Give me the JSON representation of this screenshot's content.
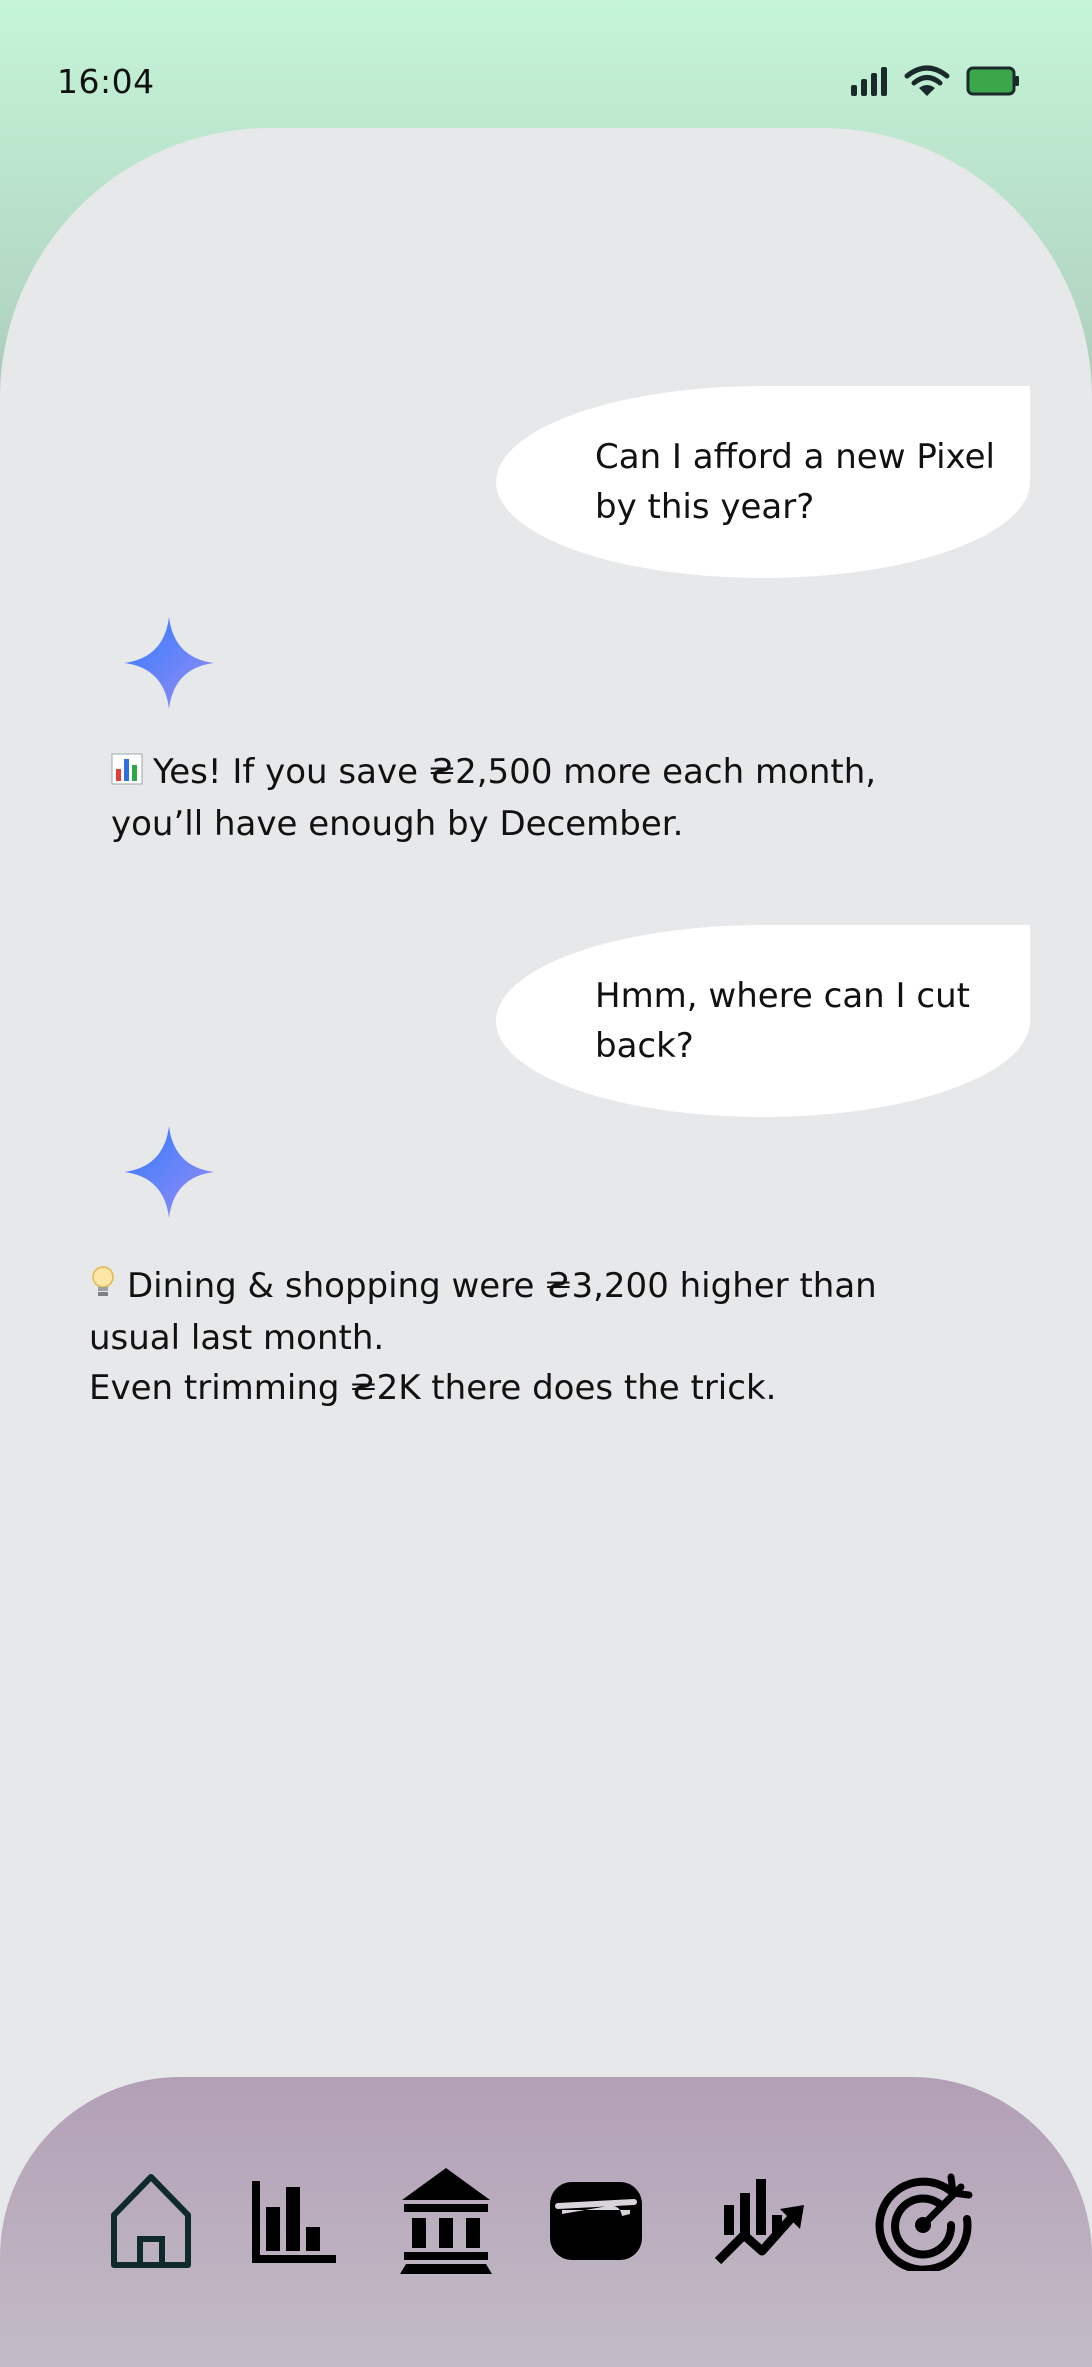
{
  "status_bar": {
    "time": "16:04",
    "battery_color": "#3aa84a"
  },
  "chat": {
    "messages": [
      {
        "role": "user",
        "text": "Can I afford a new Pixel by this year?"
      },
      {
        "role": "assistant",
        "icon": "bar-chart-emoji",
        "text": "Yes! If you save ₴2,500 more each month, you’ll have enough by December."
      },
      {
        "role": "user",
        "text": "Hmm, where can I cut back?"
      },
      {
        "role": "assistant",
        "icon": "lightbulb-emoji",
        "line1": "Dining & shopping were ₴3,200 higher than usual last month.",
        "line2": "Even trimming ₴2K there does the trick."
      }
    ],
    "assistant_icon": "gemini-sparkle-icon",
    "accent_colors": [
      "#2f7bff",
      "#8e8cf6"
    ]
  },
  "nav": {
    "items": [
      {
        "icon": "home-icon"
      },
      {
        "icon": "bar-chart-icon"
      },
      {
        "icon": "bank-icon"
      },
      {
        "icon": "wallet-icon"
      },
      {
        "icon": "trending-up-icon"
      },
      {
        "icon": "target-icon"
      }
    ]
  }
}
